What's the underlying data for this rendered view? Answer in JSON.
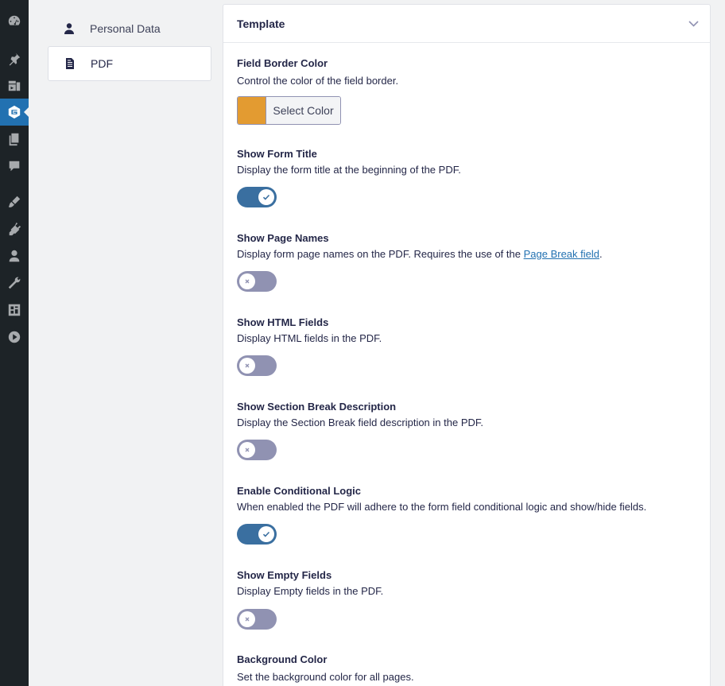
{
  "admin_menu": {
    "icons": [
      "dashboard-icon",
      "pin-icon",
      "media-icon",
      "gravity-forms-icon",
      "pages-icon",
      "comments-icon",
      "appearance-icon",
      "plugins-icon",
      "users-icon",
      "tools-icon",
      "settings-icon",
      "play-icon"
    ]
  },
  "subnav": {
    "items": [
      {
        "label": "Personal Data",
        "icon": "user-icon"
      },
      {
        "label": "PDF",
        "icon": "document-icon"
      }
    ],
    "active": "PDF"
  },
  "panel": {
    "title": "Template",
    "colors": {
      "swatch": "#e39b31",
      "toggle_on": "#3a6fa0",
      "toggle_off": "#9092b2"
    },
    "fields": [
      {
        "title": "Field Border Color",
        "desc": "Control the color of the field border.",
        "button": "Select Color"
      },
      {
        "title": "Show Form Title",
        "desc": "Display the form title at the beginning of the PDF.",
        "on": true
      },
      {
        "title": "Show Page Names",
        "desc_pre": "Display form page names on the PDF. Requires the use of the ",
        "link": "Page Break field",
        "desc_post": ".",
        "on": false
      },
      {
        "title": "Show HTML Fields",
        "desc": "Display HTML fields in the PDF.",
        "on": false
      },
      {
        "title": "Show Section Break Description",
        "desc": "Display the Section Break field description in the PDF.",
        "on": false
      },
      {
        "title": "Enable Conditional Logic",
        "desc": "When enabled the PDF will adhere to the form field conditional logic and show/hide fields.",
        "on": true
      },
      {
        "title": "Show Empty Fields",
        "desc": "Display Empty fields in the PDF.",
        "on": false
      },
      {
        "title": "Background Color",
        "desc": "Set the background color for all pages."
      }
    ]
  }
}
